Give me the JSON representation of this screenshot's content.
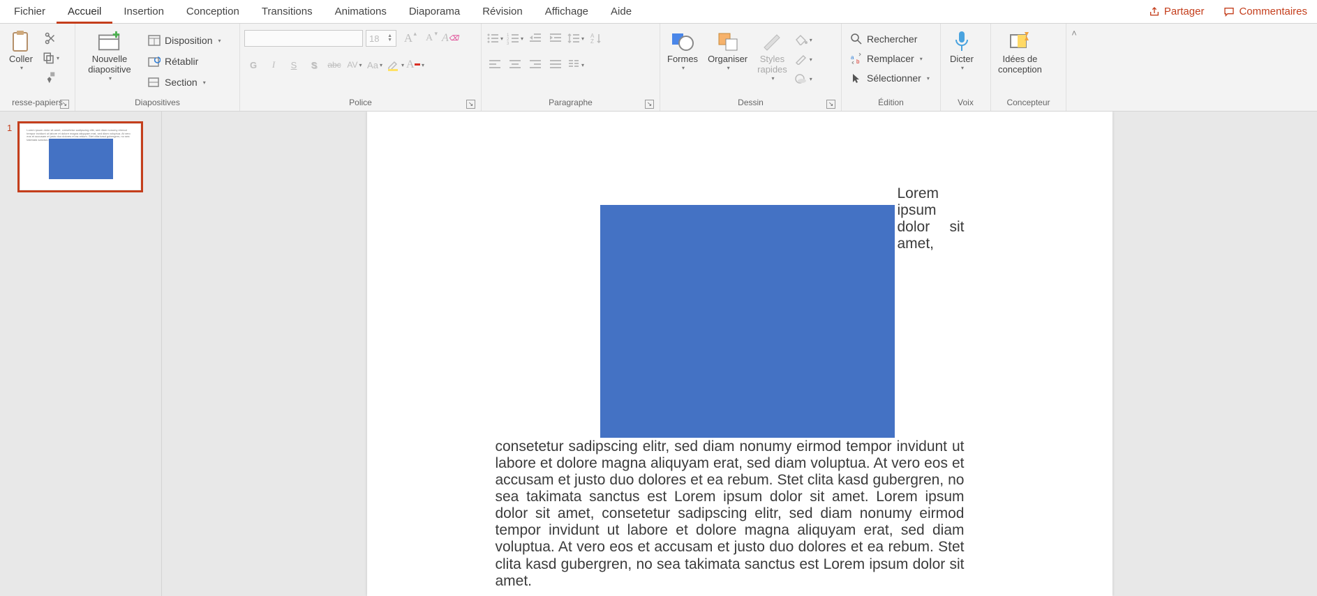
{
  "menu": {
    "tabs": [
      "Fichier",
      "Accueil",
      "Insertion",
      "Conception",
      "Transitions",
      "Animations",
      "Diaporama",
      "Révision",
      "Affichage",
      "Aide"
    ],
    "active_index": 1,
    "share": "Partager",
    "comments": "Commentaires"
  },
  "ribbon": {
    "clipboard": {
      "label": "resse-papiers",
      "paste": "Coller"
    },
    "slides": {
      "label": "Diapositives",
      "new_slide": "Nouvelle\ndiapositive",
      "layout": "Disposition",
      "reset": "Rétablir",
      "section": "Section"
    },
    "font": {
      "label": "Police",
      "size_value": "18",
      "bold": "G",
      "italic": "I",
      "underline": "S",
      "strike": "S",
      "abc": "abc",
      "av": "AV",
      "aa": "Aa"
    },
    "paragraph": {
      "label": "Paragraphe"
    },
    "drawing": {
      "label": "Dessin",
      "shapes": "Formes",
      "arrange": "Organiser",
      "quick_styles": "Styles\nrapides"
    },
    "editing": {
      "label": "Édition",
      "find": "Rechercher",
      "replace": "Remplacer",
      "select": "Sélectionner"
    },
    "voice": {
      "label": "Voix",
      "dictate": "Dicter"
    },
    "designer": {
      "label": "Concepteur",
      "ideas": "Idées de\nconception"
    }
  },
  "thumbs": {
    "first_num": "1"
  },
  "slide": {
    "body": "Lorem ipsum dolor sit amet, consetetur sadipscing elitr, sed diam nonumy eirmod tempor invidunt ut labore et dolore magna aliquyam erat, sed diam voluptua. At vero eos et accusam et justo duo dolores et ea rebum. Stet clita kasd gubergren, no sea takimata sanctus est Lorem ipsum dolor sit amet. Lorem ipsum dolor sit amet, consetetur sadipscing elitr, sed diam nonumy eirmod tempor invidunt ut labore et dolore magna aliquyam erat, sed diam voluptua. At vero eos et accusam et justo duo dolores et ea rebum. Stet clita kasd gubergren, no sea takimata sanctus est Lorem ipsum dolor sit amet."
  }
}
